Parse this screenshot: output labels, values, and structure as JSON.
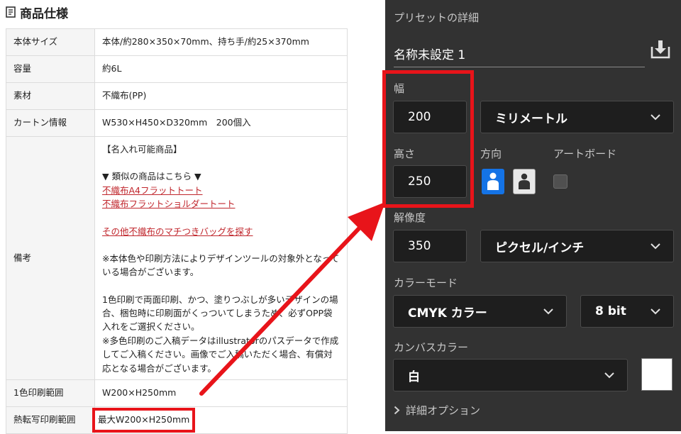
{
  "spec": {
    "title": "商品仕様",
    "rows": [
      {
        "label": "本体サイズ",
        "value": "本体/約280×350×70mm、持ち手/約25×370mm"
      },
      {
        "label": "容量",
        "value": "約6L"
      },
      {
        "label": "素材",
        "value": "不織布(PP)"
      },
      {
        "label": "カートン情報",
        "value": "W530×H450×D320mm　200個入"
      }
    ],
    "notes": {
      "label": "備考",
      "heading": "【名入れ可能商品】",
      "similar": "▼ 類似の商品はこちら ▼",
      "link1": "不織布A4フラットトート",
      "link2": "不織布フラットショルダートート",
      "link3": "その他不織布のマチつきバッグを探す",
      "note1": "※本体色や印刷方法によりデザインツールの対象外となっている場合がございます。",
      "note2": "1色印刷で両面印刷、かつ、塗りつぶしが多いデザインの場合、梱包時に印刷面がくっついてしまうため、必ずOPP袋入れをご選択ください。",
      "note3": "※多色印刷のご入稿データはillustratorのパスデータで作成してご入稿ください。画像でご入稿いただく場合、有償対応となる場合がございます。"
    },
    "print_row": {
      "label": "1色印刷範囲",
      "value": "W200×H250mm"
    },
    "transfer_row": {
      "label": "熱転写印刷範囲",
      "value": "最大W200×H250mm"
    }
  },
  "preset": {
    "title": "プリセットの詳細",
    "name": "名称未設定 1",
    "width_label": "幅",
    "width_value": "200",
    "unit": "ミリメートル",
    "height_label": "高さ",
    "height_value": "250",
    "orientation_label": "方向",
    "artboard_label": "アートボード",
    "resolution_label": "解像度",
    "resolution_value": "350",
    "resolution_unit": "ピクセル/インチ",
    "color_mode_label": "カラーモード",
    "color_mode": "CMYK カラー",
    "bit_depth": "8 bit",
    "canvas_color_label": "カンバスカラー",
    "canvas_color": "白",
    "advanced": "詳細オプション"
  },
  "colors": {
    "highlight": "#e8141a",
    "link": "#c0262c",
    "panel_bg": "#323232",
    "accent": "#1473e6"
  }
}
